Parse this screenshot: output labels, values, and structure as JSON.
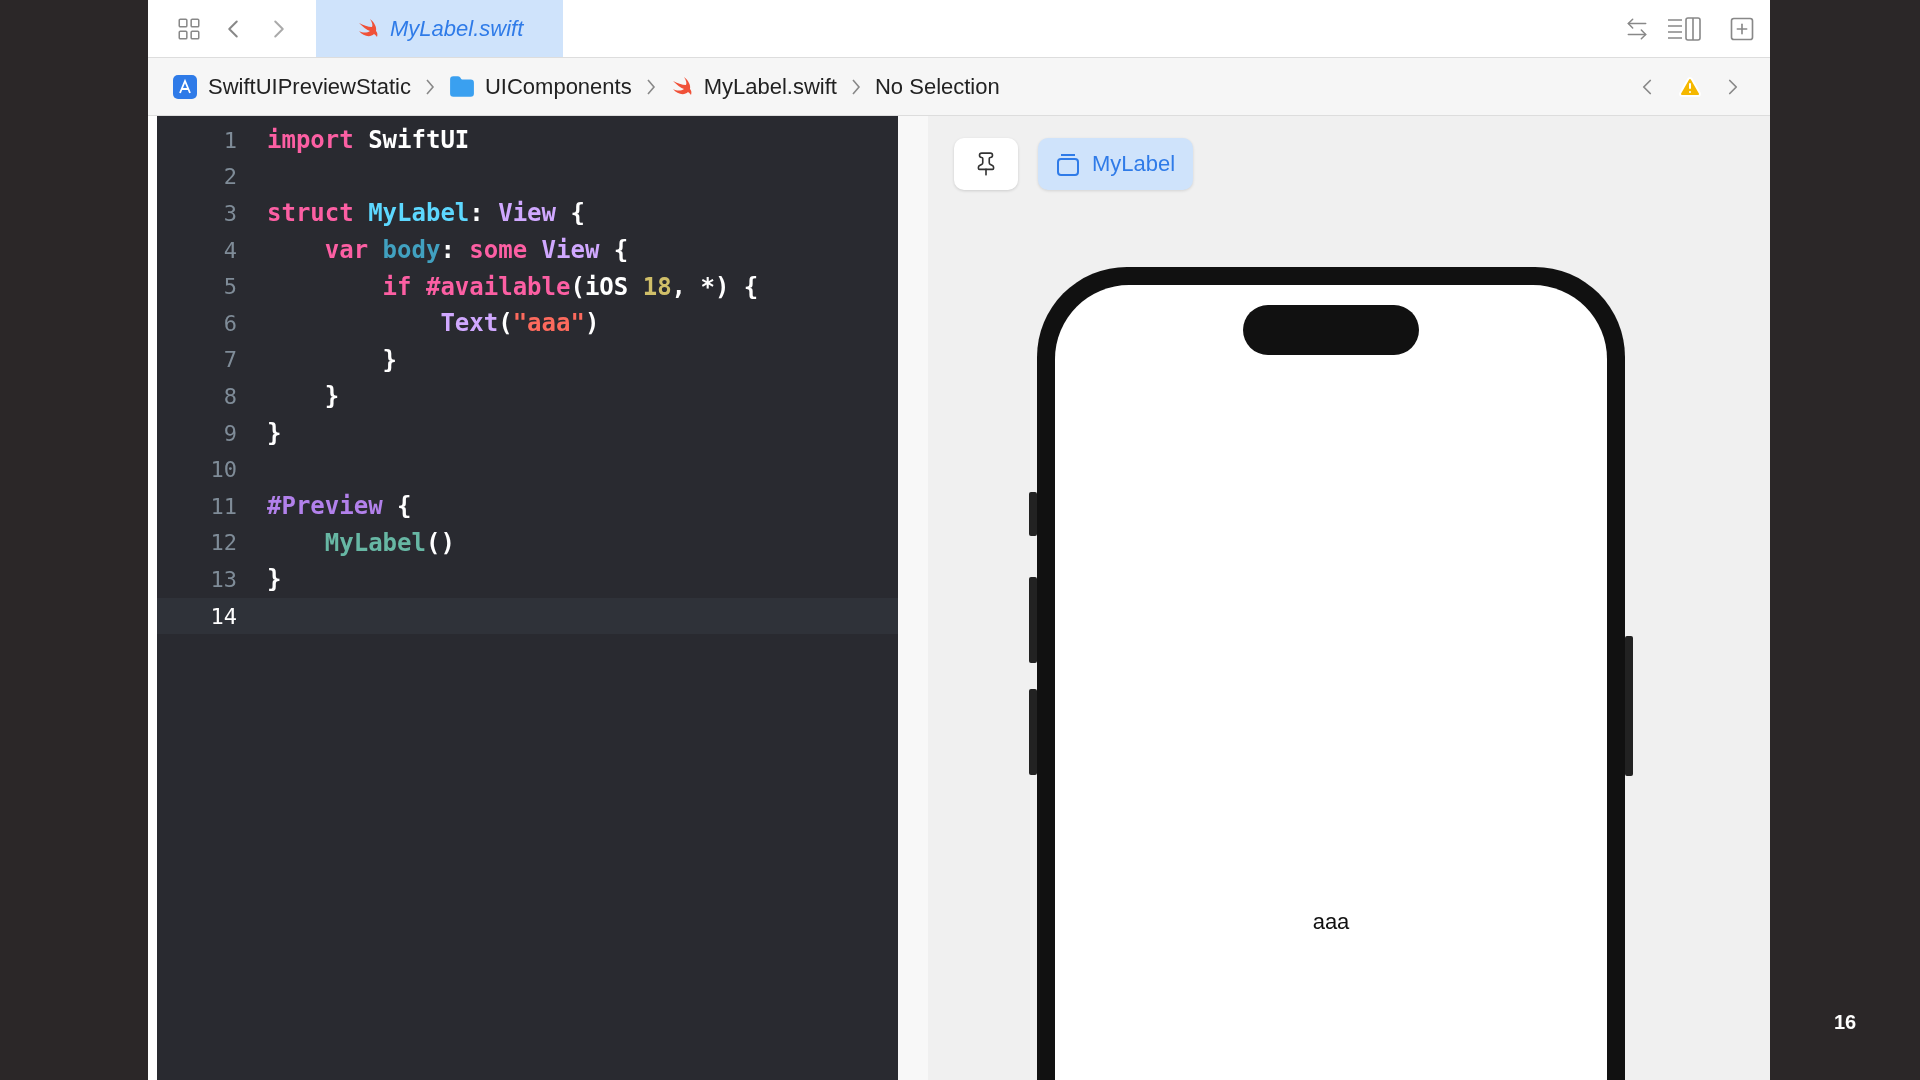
{
  "tab": {
    "title": "MyLabel.swift",
    "selected": true
  },
  "breadcrumb": [
    "SwiftUIPreviewStatic",
    "UIComponents",
    "MyLabel.swift",
    "No Selection"
  ],
  "code_lines": [
    {
      "number": "1",
      "current": false,
      "tokens": [
        {
          "kind": "keyword",
          "text": "import"
        },
        {
          "kind": "plain",
          "text": " SwiftUI"
        }
      ]
    },
    {
      "number": "2",
      "current": false
    },
    {
      "number": "3",
      "current": false,
      "tokens": [
        {
          "kind": "keyword",
          "text": "struct"
        },
        {
          "kind": "declaration",
          "text": " MyLabel"
        },
        {
          "kind": "plain",
          "text": ": "
        },
        {
          "kind": "type",
          "text": "View"
        },
        {
          "kind": "plain",
          "text": " {"
        }
      ]
    },
    {
      "number": "4",
      "current": false,
      "tokens": [
        {
          "kind": "keyword",
          "text": "    var"
        },
        {
          "kind": "property",
          "text": " body"
        },
        {
          "kind": "plain",
          "text": ": "
        },
        {
          "kind": "keyword",
          "text": "some"
        },
        {
          "kind": "type",
          "text": " View"
        },
        {
          "kind": "plain",
          "text": " {"
        }
      ]
    },
    {
      "number": "5",
      "current": false,
      "tokens": [
        {
          "kind": "keyword",
          "text": "        if"
        },
        {
          "kind": "keyword",
          "text": " #available"
        },
        {
          "kind": "plain",
          "text": "(iOS "
        },
        {
          "kind": "number",
          "text": "18"
        },
        {
          "kind": "plain",
          "text": ", *) {"
        }
      ]
    },
    {
      "number": "6",
      "current": false,
      "tokens": [
        {
          "kind": "type",
          "text": "            Text"
        },
        {
          "kind": "plain",
          "text": "("
        },
        {
          "kind": "string",
          "text": "\"aaa\""
        },
        {
          "kind": "plain",
          "text": ")"
        }
      ]
    },
    {
      "number": "7",
      "current": false,
      "tokens": [
        {
          "kind": "plain",
          "text": "        }"
        }
      ]
    },
    {
      "number": "8",
      "current": false,
      "tokens": [
        {
          "kind": "plain",
          "text": "    }"
        }
      ]
    },
    {
      "number": "9",
      "current": false,
      "tokens": [
        {
          "kind": "plain",
          "text": "}"
        }
      ]
    },
    {
      "number": "10",
      "current": false
    },
    {
      "number": "11",
      "current": false,
      "tokens": [
        {
          "kind": "macro",
          "text": "#Preview"
        },
        {
          "kind": "plain",
          "text": " {"
        }
      ]
    },
    {
      "number": "12",
      "current": false,
      "tokens": [
        {
          "kind": "call",
          "text": "    MyLabel"
        },
        {
          "kind": "plain",
          "text": "()"
        }
      ]
    },
    {
      "number": "13",
      "current": false,
      "tokens": [
        {
          "kind": "plain",
          "text": "}"
        }
      ]
    },
    {
      "number": "14",
      "current": true
    }
  ],
  "preview": {
    "chip": "MyLabel",
    "screen_text": "aaa"
  },
  "slide_number": "16"
}
